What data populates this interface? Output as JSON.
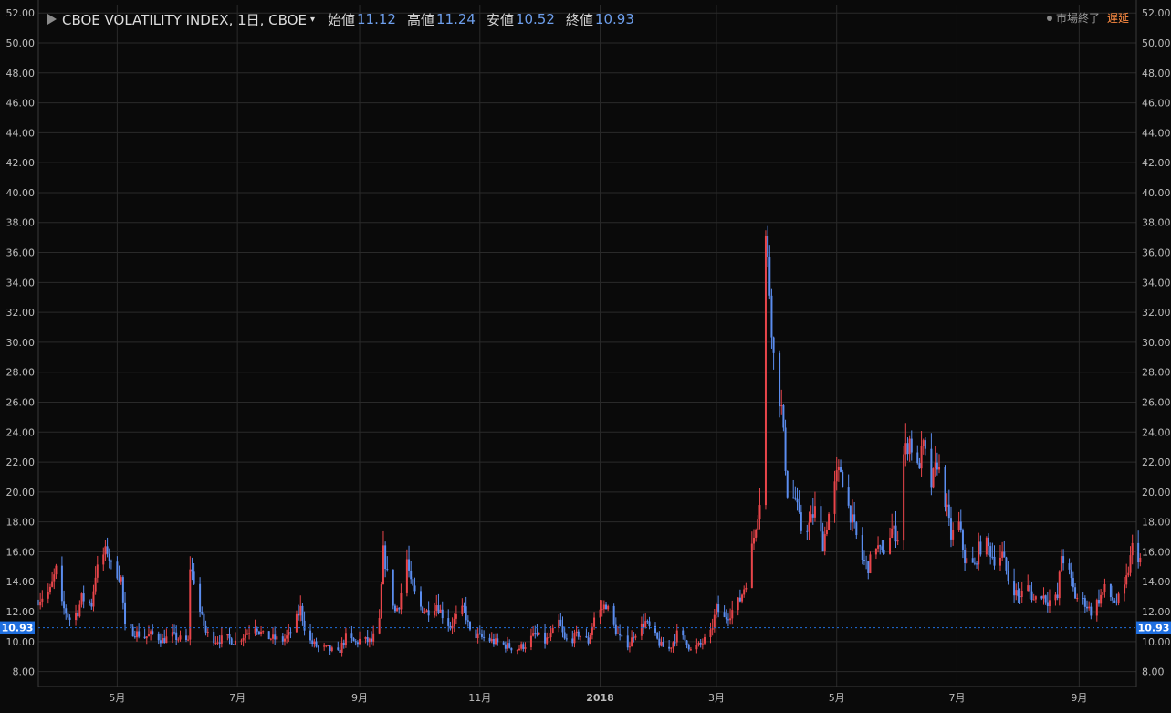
{
  "header": {
    "symbol": "CBOE VOLATILITY INDEX, 1日, CBOE",
    "caret": "▾",
    "open_label": "始値",
    "open_value": "11.12",
    "high_label": "高値",
    "high_value": "11.24",
    "low_label": "安値",
    "low_value": "10.52",
    "close_label": "終値",
    "close_value": "10.93",
    "status": "市場終了",
    "delay": "遅延"
  },
  "chart_data": {
    "type": "candlestick",
    "title": "CBOE VOLATILITY INDEX, 1日, CBOE",
    "ylim": [
      7,
      52.5
    ],
    "y_ticks": [
      8,
      10,
      12,
      14,
      16,
      18,
      20,
      22,
      24,
      26,
      28,
      30,
      32,
      34,
      36,
      38,
      40,
      42,
      44,
      46,
      48,
      50,
      52
    ],
    "y_tick_labels": [
      "8.00",
      "10.00",
      "12.00",
      "14.00",
      "16.00",
      "18.00",
      "20.00",
      "22.00",
      "24.00",
      "26.00",
      "28.00",
      "30.00",
      "32.00",
      "34.00",
      "36.00",
      "38.00",
      "40.00",
      "42.00",
      "44.00",
      "46.00",
      "48.00",
      "50.00",
      "52.00"
    ],
    "x_ticks": [
      {
        "label": "5月",
        "date": "2017-05-01"
      },
      {
        "label": "7月",
        "date": "2017-07-01"
      },
      {
        "label": "9月",
        "date": "2017-09-01"
      },
      {
        "label": "11月",
        "date": "2017-11-01"
      },
      {
        "label": "2018",
        "date": "2018-01-01"
      },
      {
        "label": "3月",
        "date": "2018-03-01"
      },
      {
        "label": "5月",
        "date": "2018-05-01"
      },
      {
        "label": "7月",
        "date": "2018-07-01"
      },
      {
        "label": "9月",
        "date": "2018-09-01"
      }
    ],
    "x_range": [
      "2017-03-22",
      "2018-09-30"
    ],
    "last_price": 10.93,
    "last_price_label": "10.93",
    "colors": {
      "up": "#e8454a",
      "down": "#5b8def",
      "grid": "#2a2a2a",
      "last": "#1f6fe0"
    },
    "grid": true,
    "series_anchors": [
      [
        "2017-03-22",
        12.8
      ],
      [
        "2017-03-28",
        13.4
      ],
      [
        "2017-03-31",
        14.8
      ],
      [
        "2017-04-03",
        12.4
      ],
      [
        "2017-04-07",
        11.5
      ],
      [
        "2017-04-11",
        12.0
      ],
      [
        "2017-04-13",
        12.9
      ],
      [
        "2017-04-18",
        12.5
      ],
      [
        "2017-04-20",
        14.5
      ],
      [
        "2017-04-24",
        15.8
      ],
      [
        "2017-04-26",
        16.1
      ],
      [
        "2017-04-28",
        15.0
      ],
      [
        "2017-05-01",
        14.6
      ],
      [
        "2017-05-03",
        14.2
      ],
      [
        "2017-05-05",
        10.9
      ],
      [
        "2017-05-10",
        10.6
      ],
      [
        "2017-05-15",
        10.3
      ],
      [
        "2017-05-19",
        10.5
      ],
      [
        "2017-05-24",
        10.1
      ],
      [
        "2017-05-29",
        10.4
      ],
      [
        "2017-06-01",
        10.2
      ],
      [
        "2017-06-06",
        10.0
      ],
      [
        "2017-06-07",
        15.0
      ],
      [
        "2017-06-09",
        14.1
      ],
      [
        "2017-06-12",
        12.0
      ],
      [
        "2017-06-15",
        10.6
      ],
      [
        "2017-06-20",
        10.1
      ],
      [
        "2017-06-26",
        10.2
      ],
      [
        "2017-06-30",
        10.0
      ],
      [
        "2017-07-05",
        10.5
      ],
      [
        "2017-07-10",
        11.1
      ],
      [
        "2017-07-14",
        10.4
      ],
      [
        "2017-07-19",
        10.2
      ],
      [
        "2017-07-24",
        10.1
      ],
      [
        "2017-07-27",
        10.4
      ],
      [
        "2017-07-31",
        11.5
      ],
      [
        "2017-08-02",
        12.2
      ],
      [
        "2017-08-04",
        11.0
      ],
      [
        "2017-08-07",
        10.0
      ],
      [
        "2017-08-11",
        9.6
      ],
      [
        "2017-08-16",
        9.5
      ],
      [
        "2017-08-21",
        9.2
      ],
      [
        "2017-08-25",
        10.3
      ],
      [
        "2017-08-30",
        9.9
      ],
      [
        "2017-09-01",
        10.1
      ],
      [
        "2017-09-07",
        10.0
      ],
      [
        "2017-09-11",
        11.3
      ],
      [
        "2017-09-13",
        16.0
      ],
      [
        "2017-09-15",
        14.5
      ],
      [
        "2017-09-19",
        12.0
      ],
      [
        "2017-09-21",
        12.5
      ],
      [
        "2017-09-25",
        15.5
      ],
      [
        "2017-09-27",
        13.8
      ],
      [
        "2017-10-02",
        12.3
      ],
      [
        "2017-10-05",
        12.0
      ],
      [
        "2017-10-10",
        12.5
      ],
      [
        "2017-10-13",
        11.8
      ],
      [
        "2017-10-17",
        11.0
      ],
      [
        "2017-10-20",
        11.6
      ],
      [
        "2017-10-24",
        12.2
      ],
      [
        "2017-10-27",
        10.6
      ],
      [
        "2017-11-01",
        10.3
      ],
      [
        "2017-11-06",
        10.1
      ],
      [
        "2017-11-10",
        9.9
      ],
      [
        "2017-11-15",
        9.7
      ],
      [
        "2017-11-20",
        9.5
      ],
      [
        "2017-11-24",
        9.8
      ],
      [
        "2017-11-29",
        10.5
      ],
      [
        "2017-12-04",
        10.0
      ],
      [
        "2017-12-07",
        10.4
      ],
      [
        "2017-12-11",
        11.3
      ],
      [
        "2017-12-14",
        10.1
      ],
      [
        "2017-12-18",
        10.2
      ],
      [
        "2017-12-21",
        10.5
      ],
      [
        "2017-12-26",
        10.0
      ],
      [
        "2017-12-29",
        11.6
      ],
      [
        "2018-01-04",
        12.5
      ],
      [
        "2018-01-08",
        11.0
      ],
      [
        "2018-01-11",
        10.2
      ],
      [
        "2018-01-16",
        9.8
      ],
      [
        "2018-01-18",
        10.5
      ],
      [
        "2018-01-24",
        11.3
      ],
      [
        "2018-01-29",
        10.3
      ],
      [
        "2018-02-01",
        9.7
      ],
      [
        "2018-02-05",
        9.5
      ],
      [
        "2018-02-07",
        10.0
      ],
      [
        "2018-02-09",
        10.5
      ],
      [
        "2018-02-14",
        10.0
      ],
      [
        "2018-02-16",
        9.4
      ],
      [
        "2018-02-21",
        9.8
      ],
      [
        "2018-02-26",
        10.5
      ],
      [
        "2018-03-01",
        12.2
      ],
      [
        "2018-03-05",
        11.5
      ],
      [
        "2018-03-08",
        11.9
      ],
      [
        "2018-03-13",
        12.8
      ],
      [
        "2018-03-16",
        14.0
      ],
      [
        "2018-03-20",
        17.0
      ],
      [
        "2018-03-23",
        19.5
      ],
      [
        "2018-03-26",
        37.0
      ],
      [
        "2018-03-28",
        33.5
      ],
      [
        "2018-03-30",
        29.0
      ],
      [
        "2018-04-03",
        25.5
      ],
      [
        "2018-04-06",
        20.0
      ],
      [
        "2018-04-10",
        19.5
      ],
      [
        "2018-04-13",
        17.5
      ],
      [
        "2018-04-17",
        17.8
      ],
      [
        "2018-04-20",
        18.8
      ],
      [
        "2018-04-24",
        16.5
      ],
      [
        "2018-04-27",
        18.5
      ],
      [
        "2018-05-01",
        21.0
      ],
      [
        "2018-05-03",
        21.5
      ],
      [
        "2018-05-07",
        19.0
      ],
      [
        "2018-05-10",
        17.5
      ],
      [
        "2018-05-14",
        15.5
      ],
      [
        "2018-05-17",
        15.0
      ],
      [
        "2018-05-21",
        16.5
      ],
      [
        "2018-05-24",
        15.8
      ],
      [
        "2018-05-29",
        17.5
      ],
      [
        "2018-06-01",
        17.0
      ],
      [
        "2018-06-04",
        22.5
      ],
      [
        "2018-06-07",
        23.5
      ],
      [
        "2018-06-11",
        21.5
      ],
      [
        "2018-06-14",
        23.0
      ],
      [
        "2018-06-18",
        20.5
      ],
      [
        "2018-06-21",
        22.0
      ],
      [
        "2018-06-25",
        19.5
      ],
      [
        "2018-06-28",
        17.0
      ],
      [
        "2018-07-02",
        17.8
      ],
      [
        "2018-07-05",
        15.5
      ],
      [
        "2018-07-10",
        15.0
      ],
      [
        "2018-07-12",
        16.2
      ],
      [
        "2018-07-16",
        16.5
      ],
      [
        "2018-07-20",
        15.5
      ],
      [
        "2018-07-24",
        15.8
      ],
      [
        "2018-07-27",
        14.2
      ],
      [
        "2018-08-01",
        13.0
      ],
      [
        "2018-08-06",
        13.6
      ],
      [
        "2018-08-09",
        12.8
      ],
      [
        "2018-08-13",
        13.2
      ],
      [
        "2018-08-16",
        12.7
      ],
      [
        "2018-08-21",
        12.9
      ],
      [
        "2018-08-23",
        15.8
      ],
      [
        "2018-08-27",
        14.5
      ],
      [
        "2018-08-30",
        13.0
      ],
      [
        "2018-09-04",
        12.6
      ],
      [
        "2018-09-07",
        12.0
      ],
      [
        "2018-09-11",
        12.8
      ],
      [
        "2018-09-14",
        13.5
      ],
      [
        "2018-09-18",
        12.8
      ],
      [
        "2018-09-20",
        12.6
      ],
      [
        "2018-09-24",
        13.5
      ],
      [
        "2018-09-26",
        14.8
      ],
      [
        "2018-09-28",
        16.3
      ],
      [
        "2018-10-02",
        15.5
      ]
    ]
  }
}
